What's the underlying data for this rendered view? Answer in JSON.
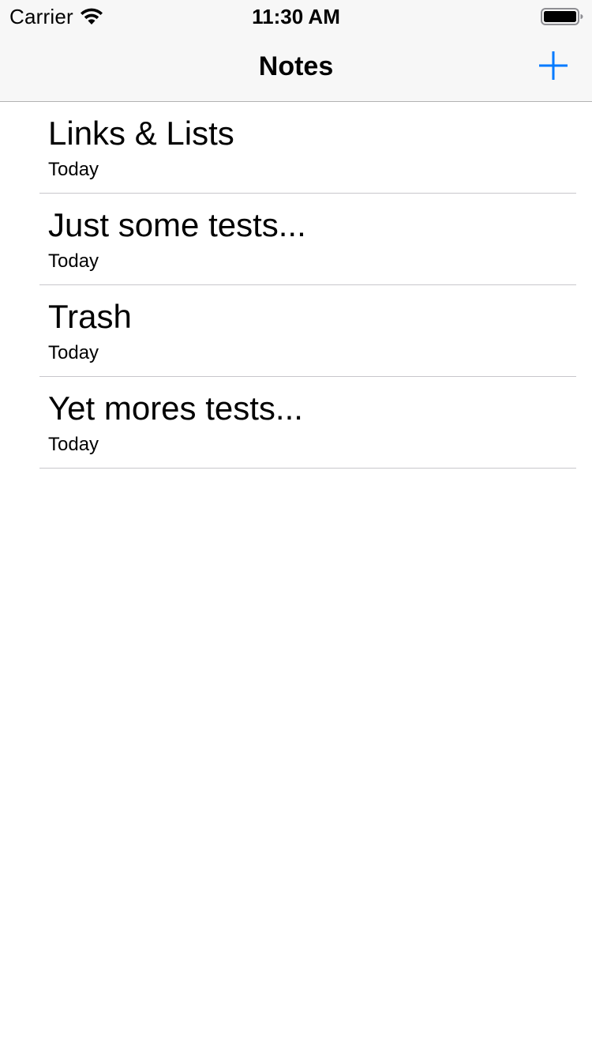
{
  "status_bar": {
    "carrier": "Carrier",
    "time": "11:30 AM"
  },
  "nav": {
    "title": "Notes",
    "add_icon": "plus-icon"
  },
  "colors": {
    "accent": "#007aff",
    "bar_background": "#f7f7f7",
    "separator": "#c8c7cc"
  },
  "notes": [
    {
      "title": "Links & Lists",
      "date": "Today"
    },
    {
      "title": "Just some tests...",
      "date": "Today"
    },
    {
      "title": "Trash",
      "date": "Today"
    },
    {
      "title": "Yet mores tests...",
      "date": "Today"
    }
  ]
}
